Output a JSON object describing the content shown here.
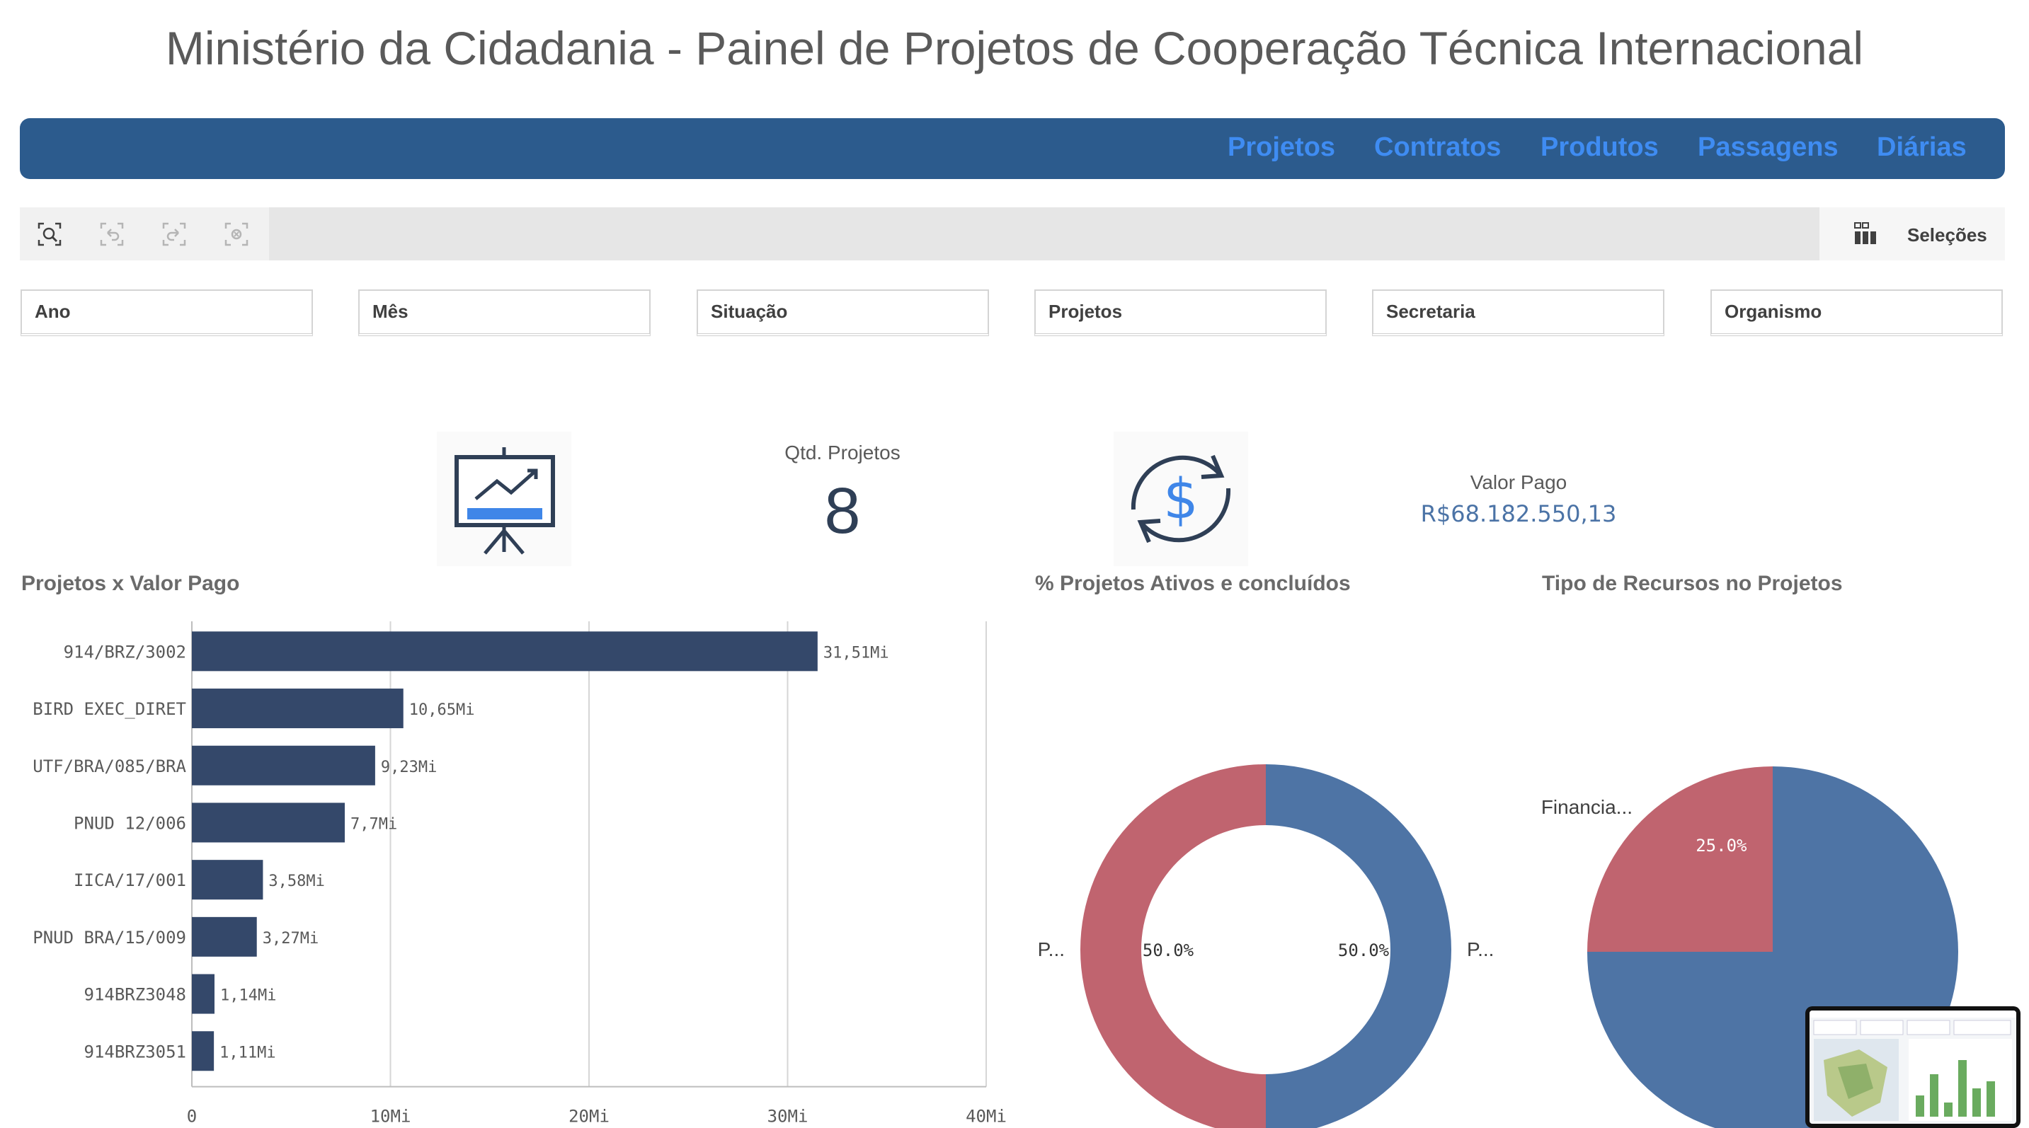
{
  "header": {
    "title": "Ministério da Cidadania - Painel de Projetos de Cooperação Técnica Internacional"
  },
  "nav": {
    "items": [
      "Projetos",
      "Contratos",
      "Produtos",
      "Passagens",
      "Diárias"
    ],
    "bar_color": "#2c5b8d",
    "link_color": "#3f8cf2"
  },
  "toolbar": {
    "selections_label": "Seleções"
  },
  "filters": [
    "Ano",
    "Mês",
    "Situação",
    "Projetos",
    "Secretaria",
    "Organismo"
  ],
  "kpis": {
    "projects_label": "Qtd. Projetos",
    "projects_value": "8",
    "paid_label": "Valor Pago",
    "paid_value": "R$68.182.550,13"
  },
  "icons": {
    "presentation": "presentation-chart-icon",
    "money_cycle": "dollar-refresh-icon"
  },
  "chart_data": [
    {
      "type": "bar",
      "title": "Projetos x Valor Pago",
      "orientation": "horizontal",
      "categories": [
        "914/BRZ/3002",
        "BIRD EXEC_DIRET",
        "UTF/BRA/085/BRA",
        "PNUD 12/006",
        "IICA/17/001",
        "PNUD BRA/15/009",
        "914BRZ3048",
        "914BRZ3051"
      ],
      "values": [
        31.51,
        10.65,
        9.23,
        7.7,
        3.58,
        3.27,
        1.14,
        1.11
      ],
      "value_labels": [
        "31,51Mi",
        "10,65Mi",
        "9,23Mi",
        "7,7Mi",
        "3,58Mi",
        "3,27Mi",
        "1,14Mi",
        "1,11Mi"
      ],
      "xlim": [
        0,
        40
      ],
      "x_ticks": [
        "0",
        "10Mi",
        "20Mi",
        "30Mi",
        "40Mi"
      ],
      "grid": true,
      "color": "#34486a"
    },
    {
      "type": "pie",
      "variant": "donut",
      "title": "% Projetos Ativos e concluídos",
      "slices": [
        {
          "label": "P...",
          "value": 50.0,
          "text": "50.0%",
          "color": "#4e74a5"
        },
        {
          "label": "P...",
          "value": 50.0,
          "text": "50.0%",
          "color": "#c0646f"
        }
      ]
    },
    {
      "type": "pie",
      "title": "Tipo de Recursos no Projetos",
      "slices": [
        {
          "label": "",
          "value": 75.0,
          "color": "#4e74a5"
        },
        {
          "label": "Financia...",
          "value": 25.0,
          "text": "25.0%",
          "color": "#c0646f"
        }
      ]
    }
  ]
}
